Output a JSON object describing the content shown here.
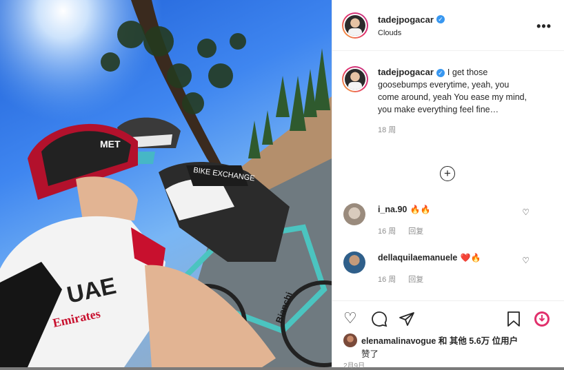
{
  "post": {
    "username": "tadejpogacar",
    "audio": "Clouds",
    "caption": "I get those goosebumps everytime, yeah, you come around, yeah You ease my mind, you make everything feel fine…",
    "caption_time": "18 周",
    "photo_text": {
      "jersey_left": "UAE",
      "sponsor": "Emirates",
      "helmet_left": "MET",
      "jersey_right": "BIKE EXCHANGE",
      "bike_brand": "Bianchi"
    }
  },
  "comments": [
    {
      "username": "i_na.90",
      "emoji": "🔥🔥",
      "time": "16 周",
      "reply": "回复"
    },
    {
      "username": "dellaquilaemanuele",
      "emoji": "❤️🔥",
      "time": "16 周",
      "reply": "回复"
    }
  ],
  "likes": {
    "user": "elenamalinavogue",
    "text": "和 其他 5.6万 位用户",
    "suffix": "赞了"
  },
  "date": "2月9日",
  "icons": {
    "verified": "verified-badge-icon",
    "more": "more-options-icon",
    "add": "add-comment-icon",
    "heart": "heart-icon",
    "comment": "comment-icon",
    "share": "share-icon",
    "save": "bookmark-icon"
  },
  "colors": {
    "verified": "#3897f0",
    "brand_ring": "#e1306c",
    "text": "#262626",
    "muted": "#8e8e8e"
  }
}
